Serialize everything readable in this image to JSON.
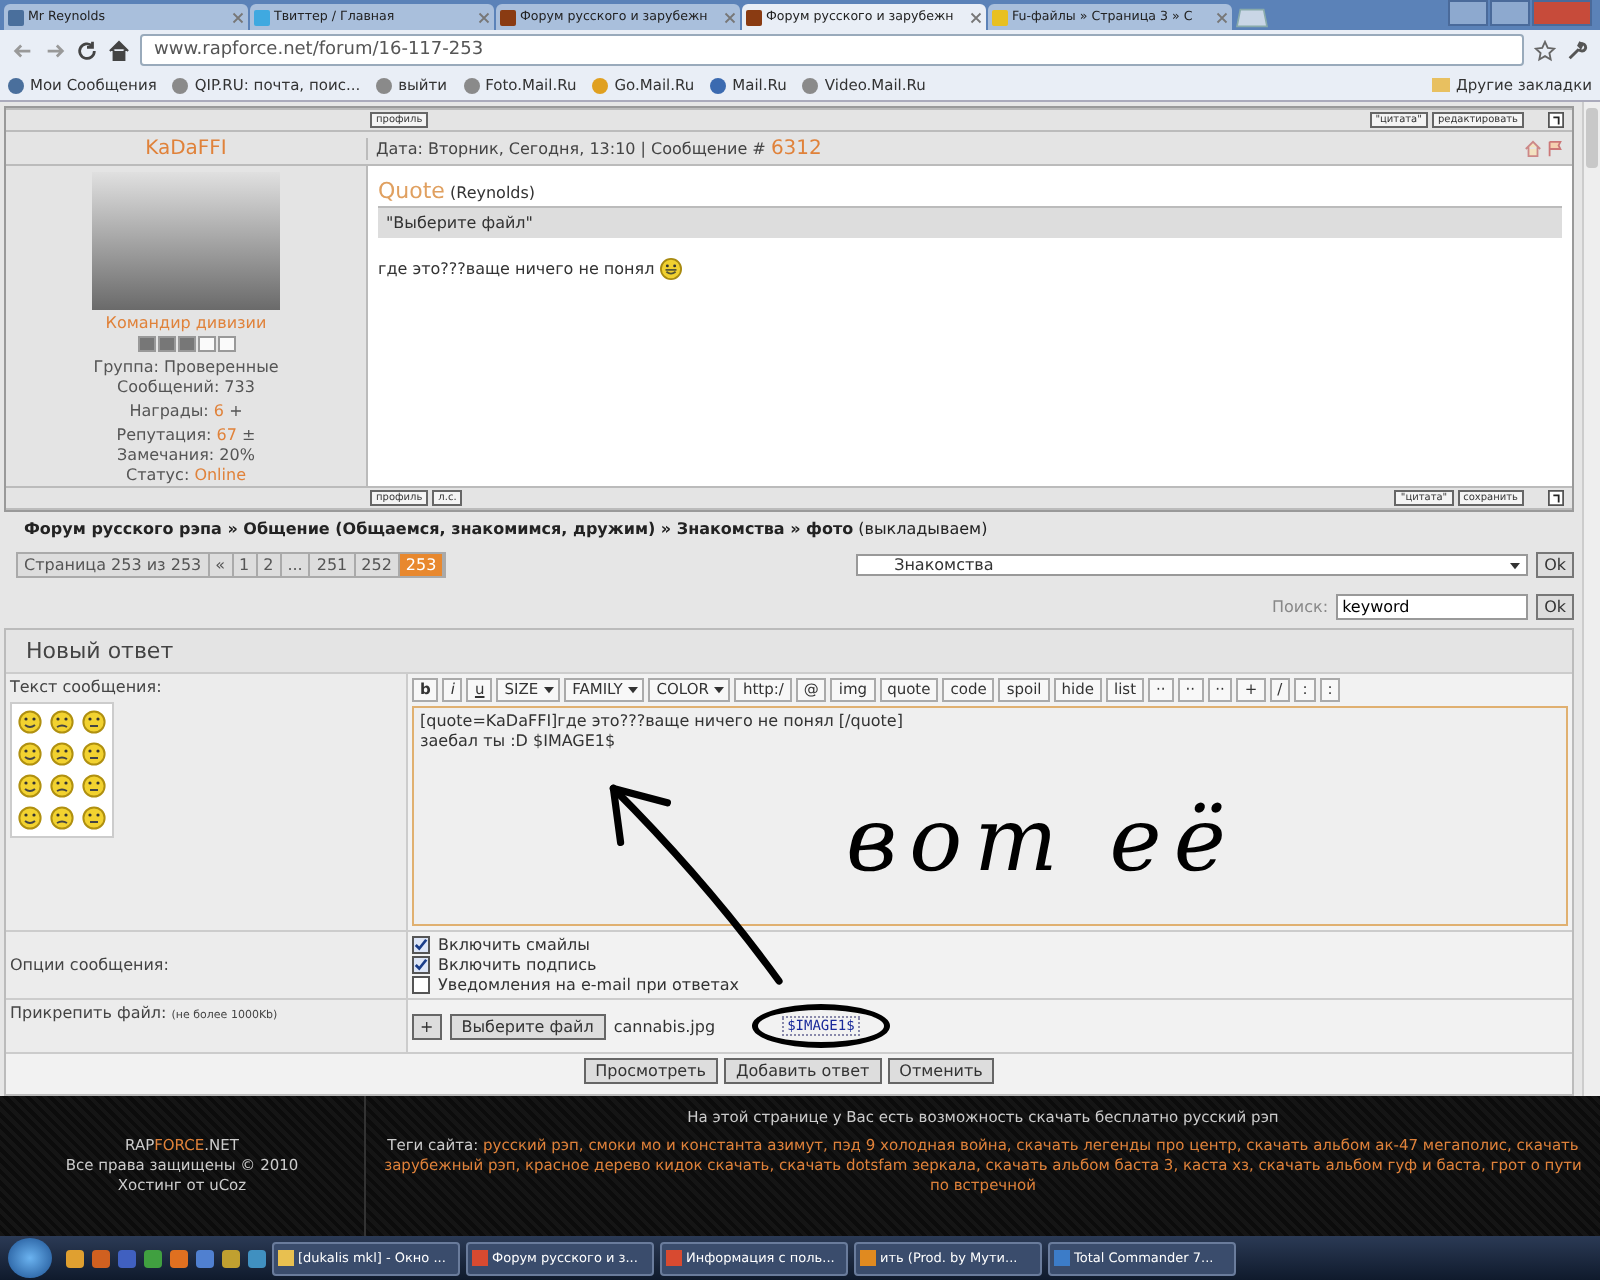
{
  "browser": {
    "tabs": [
      {
        "title": "Mr Reynolds",
        "kind": "vk",
        "selected": false
      },
      {
        "title": "Твиттер / Главная",
        "kind": "bird",
        "selected": false
      },
      {
        "title": "Форум русского и зарубежн",
        "kind": "forum",
        "selected": false
      },
      {
        "title": "Форум русского и зарубежн",
        "kind": "forum",
        "selected": true
      },
      {
        "title": "Fu-файлы » Страница 3 » C",
        "kind": "smiley",
        "selected": false
      }
    ],
    "url": "www.rapforce.net/forum/16-117-253",
    "bookmarks": [
      {
        "label": "Мои Сообщения",
        "kind": "vk"
      },
      {
        "label": "QIP.RU: почта, поис...",
        "kind": "globe"
      },
      {
        "label": "выйти",
        "kind": "globe"
      },
      {
        "label": "Foto.Mail.Ru",
        "kind": "globe"
      },
      {
        "label": "Go.Mail.Ru",
        "kind": "search"
      },
      {
        "label": "Mail.Ru",
        "kind": "mail"
      },
      {
        "label": "Video.Mail.Ru",
        "kind": "globe"
      }
    ],
    "other_bookmarks": "Другие закладки"
  },
  "post": {
    "top_left_buttons": [
      "профиль"
    ],
    "top_right_buttons": [
      "\"цитата\"",
      "редактировать"
    ],
    "author": {
      "name": "KaDaFFI",
      "rank": "Командир дивизии",
      "stars": 3,
      "group": "Группа: Проверенные",
      "posts": "Сообщений: 733",
      "awards_label": "Награды:",
      "awards": "6",
      "awards_action": "+",
      "reputation_label": "Репутация:",
      "reputation": "67",
      "reputation_action": "±",
      "warnings": "Замечания: 20%",
      "status_label": "Статус:",
      "status": "Online"
    },
    "date": "Дата: Вторник, Сегодня, 13:10 | Сообщение #",
    "number": "6312",
    "quote": {
      "label": "Quote",
      "author": "(Reynolds)",
      "text": "\"Выберите файл\""
    },
    "message": "где это???ваще ничего не понял",
    "bottom_left_buttons": [
      "профиль",
      "л.с."
    ],
    "bottom_right_buttons": [
      "\"цитата\"",
      "сохранить"
    ]
  },
  "breadcrumb": "**Форум русского рэпа » Общение (Общаемся, знакомимся, дружим) » Знакомства » фото** (выкладываем)",
  "pagination": {
    "label": "Страница 253 из 253",
    "pages": [
      {
        "label": "«",
        "selected": false
      },
      {
        "label": "1",
        "selected": false
      },
      {
        "label": "2",
        "selected": false
      },
      {
        "label": "...",
        "selected": false
      },
      {
        "label": "251",
        "selected": false
      },
      {
        "label": "252",
        "selected": false
      },
      {
        "label": "253",
        "selected": true
      }
    ]
  },
  "forum_jump": {
    "value": "Знакомства",
    "button": "Ok"
  },
  "search": {
    "label": "Поиск:",
    "value": "keyword",
    "button": "Ok"
  },
  "reply": {
    "title": "Новый ответ",
    "text_label": "Текст сообщения:",
    "toolbar": [
      {
        "label": "b",
        "kind": "button"
      },
      {
        "label": "i",
        "kind": "button"
      },
      {
        "label": "u",
        "kind": "button"
      },
      {
        "label": "SIZE",
        "kind": "select"
      },
      {
        "label": "FAMILY",
        "kind": "select"
      },
      {
        "label": "COLOR",
        "kind": "select"
      },
      {
        "label": "http:/",
        "kind": "button"
      },
      {
        "label": "@",
        "kind": "button"
      },
      {
        "label": "img",
        "kind": "button"
      },
      {
        "label": "quote",
        "kind": "button"
      },
      {
        "label": "code",
        "kind": "button"
      },
      {
        "label": "spoil",
        "kind": "button"
      },
      {
        "label": "hide",
        "kind": "button"
      },
      {
        "label": "list",
        "kind": "button"
      },
      {
        "label": "··",
        "kind": "button"
      },
      {
        "label": "··",
        "kind": "button"
      },
      {
        "label": "··",
        "kind": "button"
      },
      {
        "label": "+",
        "kind": "button"
      },
      {
        "label": "/",
        "kind": "button"
      },
      {
        "label": ":",
        "kind": "button"
      },
      {
        "label": ":",
        "kind": "button"
      }
    ],
    "text": "[quote=KaDaFFI]где это???ваще ничего не понял [/quote]\nзаебал ты :D $IMAGE1$",
    "options_label": "Опции сообщения:",
    "options": [
      {
        "label": "Включить смайлы",
        "checked": true
      },
      {
        "label": "Включить подпись",
        "checked": true
      },
      {
        "label": "Уведомления на e-mail при ответах",
        "checked": false
      }
    ],
    "attach_label": "Прикрепить файл:",
    "attach_note": "(не более 1000Kb)",
    "attach_add": "+",
    "attach_button": "Выберите файл",
    "file_name": "cannabis.jpg",
    "file_tag": "$IMAGE1$",
    "buttons": [
      "Просмотреть",
      "Добавить ответ",
      "Отменить"
    ]
  },
  "annotation": "вот её",
  "footer": {
    "logo_parts": [
      "RAP",
      "FORCE",
      ".NET"
    ],
    "copyright": "Все права защищены © 2010",
    "hosting": "Хостинг от uCoz",
    "intro": "На этой странице у Вас есть возможность скачать бесплатно русский рэп",
    "tags_label": "Теги сайта:",
    "tags": "русский рэп, смоки мо и константа азимут, пэд 9 холодная война, скачать легенды про центр, скачать альбом ак-47 мегаполис, скачать зарубежный рэп, красное дерево кидок скачать, скачать dotsfam зеркала, скачать альбом баста 3, каста хз, скачать альбом гуф и баста, грот о пути по встречной"
  },
  "taskbar": {
    "tasks": [
      {
        "title": "[dukalis mkl] - Окно ...",
        "kind": "folder"
      },
      {
        "title": "Форум русского и з...",
        "kind": "browser"
      },
      {
        "title": "Информация с поль...",
        "kind": "browser"
      },
      {
        "title": "ить (Prod. by Мути...",
        "kind": "player"
      },
      {
        "title": "Total Commander 7...",
        "kind": "disk"
      }
    ]
  }
}
